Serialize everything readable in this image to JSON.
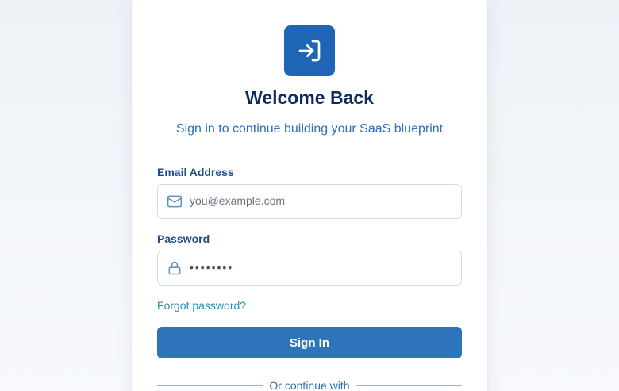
{
  "login": {
    "title": "Welcome Back",
    "subtitle": "Sign in to continue building your SaaS blueprint",
    "email_label": "Email Address",
    "email_placeholder": "you@example.com",
    "email_value": "",
    "password_label": "Password",
    "password_value": "password",
    "forgot_link": "Forgot password?",
    "signin_button": "Sign In",
    "divider_text": "Or continue with"
  },
  "icons": {
    "logo": "sign-in-icon",
    "email": "mail-icon",
    "password": "lock-icon"
  },
  "colors": {
    "brand": "#1f65b5",
    "button": "#2d74ba",
    "title": "#0f2a5e",
    "subtitle": "#2a6fb8",
    "link": "#2a8ab8",
    "label": "#1e4c8a"
  }
}
